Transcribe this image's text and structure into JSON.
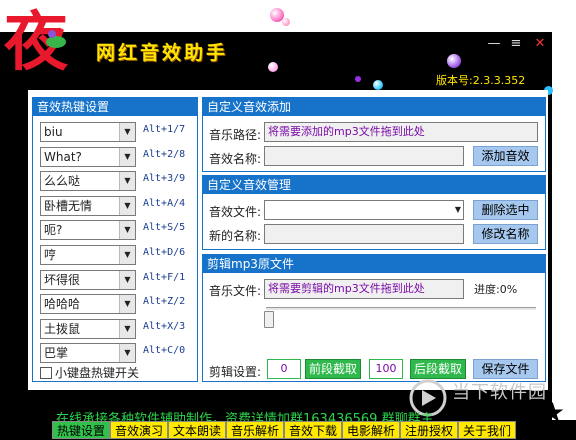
{
  "app": {
    "logo_char": "夜",
    "title": "网红音效助手",
    "version": "版本号:2.3.3.352",
    "min_glyph": "—",
    "max_glyph": "≡",
    "close_glyph": "✕"
  },
  "hotkeys": {
    "title": "音效热键设置",
    "items": [
      {
        "label": "biu",
        "key": "Alt+1/7"
      },
      {
        "label": "What?",
        "key": "Alt+2/8"
      },
      {
        "label": "么么哒",
        "key": "Alt+3/9"
      },
      {
        "label": "卧槽无情",
        "key": "Alt+A/4"
      },
      {
        "label": "呃?",
        "key": "Alt+S/5"
      },
      {
        "label": "哼",
        "key": "Alt+D/6"
      },
      {
        "label": "坏得很",
        "key": "Alt+F/1"
      },
      {
        "label": "哈哈哈",
        "key": "Alt+Z/2"
      },
      {
        "label": "土拨鼠",
        "key": "Alt+X/3"
      },
      {
        "label": "巴掌",
        "key": "Alt+C/0"
      }
    ],
    "checkbox_label": "小键盘热键开关"
  },
  "add_panel": {
    "title": "自定义音效添加",
    "path_label": "音乐路径:",
    "path_value": "将需要添加的mp3文件拖到此处",
    "name_label": "音效名称:",
    "name_value": "",
    "add_button": "添加音效"
  },
  "manage_panel": {
    "title": "自定义音效管理",
    "file_label": "音效文件:",
    "file_value": "",
    "newname_label": "新的名称:",
    "newname_value": "",
    "delete_button": "删除选中",
    "rename_button": "修改名称"
  },
  "cut_panel": {
    "title": "剪辑mp3原文件",
    "file_label": "音乐文件:",
    "file_value": "将需要剪辑的mp3文件拖到此处",
    "progress_label": "进度:0%",
    "slider_position": 0,
    "cut_label": "剪辑设置:",
    "start_value": "0",
    "front_button": "前段截取",
    "end_value": "100",
    "back_button": "后段截取",
    "save_button": "保存文件"
  },
  "marquee": "在线承接各种软件辅助制作，资费详情加群163436569     群聊群主",
  "tabs": [
    {
      "label": "热键设置",
      "active": true
    },
    {
      "label": "音效演习",
      "active": false
    },
    {
      "label": "文本朗读",
      "active": false
    },
    {
      "label": "音乐解析",
      "active": false
    },
    {
      "label": "音效下载",
      "active": false
    },
    {
      "label": "电影解析",
      "active": false
    },
    {
      "label": "注册授权",
      "active": false
    },
    {
      "label": "关于我们",
      "active": false
    }
  ],
  "watermark": {
    "text": "当下软件园",
    "sub": "www.downxia.com"
  },
  "colors": {
    "accent": "#1673c9",
    "title_yellow": "#ffe600",
    "tab_yellow": "#ffe900",
    "tab_active": "#31c14a",
    "marquee_green": "#2cd34a"
  }
}
